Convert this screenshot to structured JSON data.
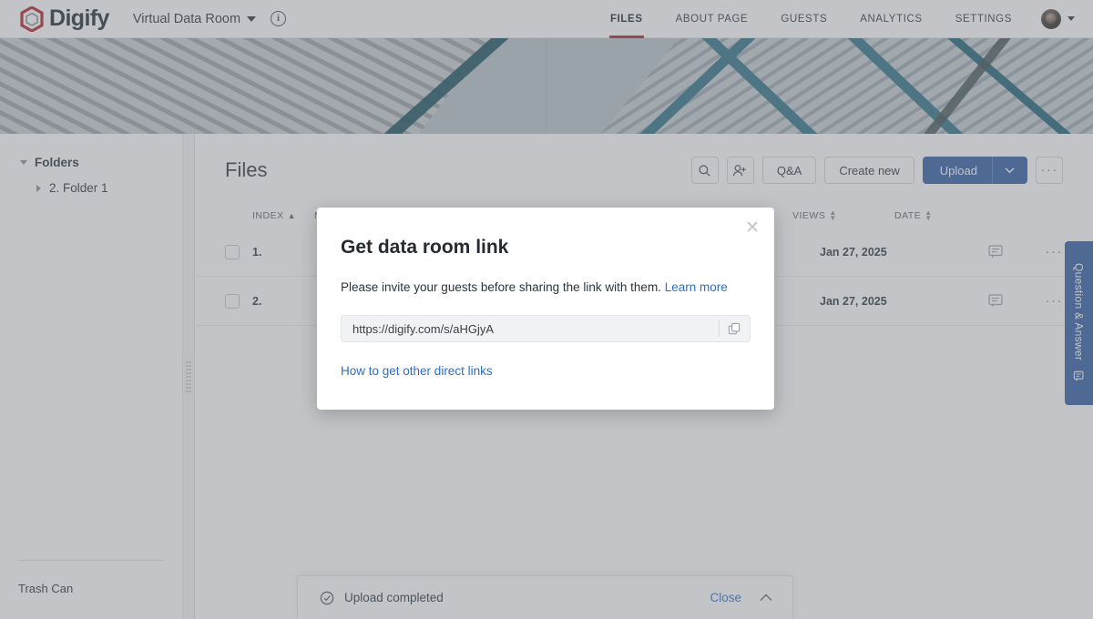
{
  "topnav": {
    "brand": "Digify",
    "room_name": "Virtual Data Room",
    "info_icon": "info-icon",
    "menu": [
      {
        "label": "FILES",
        "active": true
      },
      {
        "label": "ABOUT PAGE",
        "active": false
      },
      {
        "label": "GUESTS",
        "active": false
      },
      {
        "label": "ANALYTICS",
        "active": false
      },
      {
        "label": "SETTINGS",
        "active": false
      }
    ],
    "accent_color": "#b32025"
  },
  "sidebar": {
    "section_label": "Folders",
    "folders": [
      {
        "label": "2. Folder 1"
      }
    ],
    "trash_label": "Trash Can"
  },
  "main": {
    "title": "Files",
    "toolbar": {
      "search_icon": "search-icon",
      "invite_icon": "user-add-icon",
      "qa_label": "Q&A",
      "create_label": "Create new",
      "upload_label": "Upload",
      "upload_color": "#2c5aa0",
      "more_label": "···"
    },
    "table": {
      "headers": {
        "index": "INDEX",
        "name": "NAME",
        "views": "VIEWS",
        "date": "DATE"
      },
      "sorted_by": "INDEX",
      "sort_direction": "asc",
      "rows": [
        {
          "index": "1.",
          "name": "",
          "views": "-",
          "date": "Jan 27, 2025"
        },
        {
          "index": "2.",
          "name": "",
          "views": "",
          "date": "Jan 27, 2025"
        }
      ]
    }
  },
  "qa_tab": {
    "label": "Question & Answer",
    "icon": "comment-icon"
  },
  "toast": {
    "message": "Upload completed",
    "status_icon": "check-circle-icon",
    "close_label": "Close",
    "collapse_icon": "chevron-up-icon"
  },
  "modal": {
    "title": "Get data room link",
    "subtitle": "Please invite your guests before sharing the link with them.",
    "learn_more": "Learn more",
    "link_value": "https://digify.com/s/aHGjyA",
    "copy_icon": "copy-icon",
    "other_links": "How to get other direct links",
    "close_icon": "close-icon"
  }
}
